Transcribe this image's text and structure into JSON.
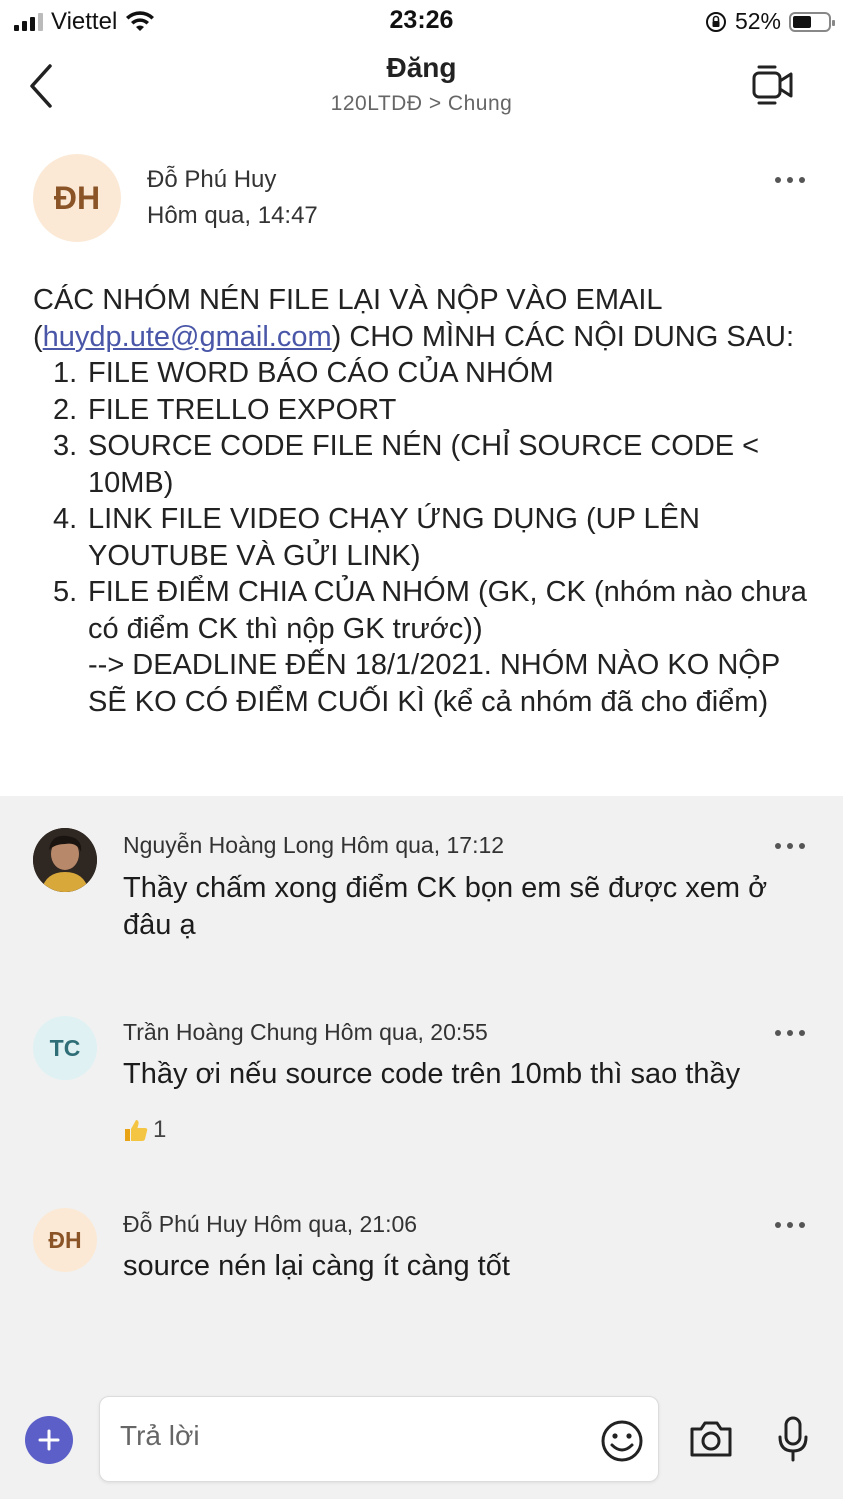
{
  "status_bar": {
    "carrier": "Viettel",
    "time": "23:26",
    "battery": "52%",
    "battery_level": 0.52
  },
  "header": {
    "title": "Đăng",
    "breadcrumb": "120LTDĐ > Chung"
  },
  "post": {
    "avatar_initials": "ĐH",
    "author": "Đỗ Phú Huy",
    "time": "Hôm qua, 14:47",
    "intro_before_email": "CÁC NHÓM NÉN FILE LẠI VÀ NỘP VÀO EMAIL (",
    "email": "huydp.ute@gmail.com",
    "intro_after_email": ") CHO MÌNH CÁC NỘI DUNG SAU:",
    "items": [
      {
        "num": "1.",
        "text": "FILE WORD BÁO CÁO CỦA NHÓM"
      },
      {
        "num": "2.",
        "text": "FILE TRELLO EXPORT"
      },
      {
        "num": "3.",
        "text": "SOURCE CODE FILE NÉN (CHỈ SOURCE CODE < 10MB)"
      },
      {
        "num": "4.",
        "text": "LINK FILE VIDEO CHẠY ỨNG DỤNG (UP LÊN YOUTUBE VÀ GỬI LINK)"
      },
      {
        "num": "5.",
        "text": "FILE ĐIỂM CHIA CỦA NHÓM (GK, CK (nhóm nào chưa có điểm CK thì nộp GK trước))"
      }
    ],
    "deadline": "--> DEADLINE ĐẾN 18/1/2021. NHÓM NÀO KO NỘP SẼ KO CÓ ĐIỂM CUỐI KÌ (kể cả nhóm đã cho điểm)"
  },
  "replies": [
    {
      "author": "Nguyễn Hoàng Long",
      "time": "Hôm qua, 17:12",
      "text": "Thầy chấm xong điểm CK bọn em sẽ được xem ở đâu ạ"
    },
    {
      "avatar_initials": "TC",
      "author": "Trần Hoàng Chung",
      "time": "Hôm qua, 20:55",
      "text": "Thầy ơi nếu source code trên 10mb thì sao thầy",
      "reaction_count": "1"
    },
    {
      "avatar_initials": "ĐH",
      "author": "Đỗ Phú Huy",
      "time": "Hôm qua, 21:06",
      "text": "source nén lại càng ít càng tốt"
    }
  ],
  "compose": {
    "placeholder": "Trả lời"
  },
  "colors": {
    "accent": "#5b5fc7",
    "link": "#4a57a8",
    "thread_bg": "#f1f1f1",
    "avatar_dh_bg": "#fbe9d6",
    "avatar_tc_bg": "#dff1f3"
  }
}
